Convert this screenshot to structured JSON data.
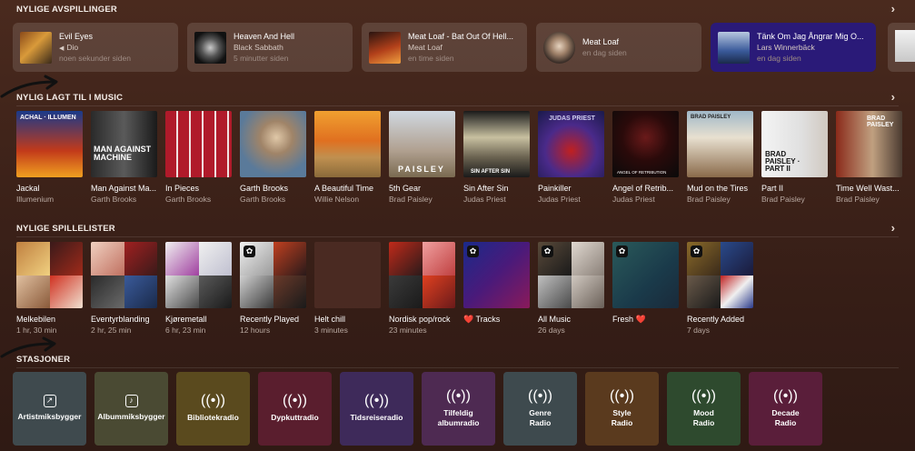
{
  "sections": {
    "recent_plays": "NYLIGE AVSPILLINGER",
    "recently_added": "NYLIG LAGT TIL I MUSIC",
    "recent_playlists": "NYLIGE SPILLELISTER",
    "stations": "STASJONER"
  },
  "recent_plays": [
    {
      "title": "Evil Eyes",
      "artist": "Dio",
      "time": "noen sekunder siden",
      "playing": true
    },
    {
      "title": "Heaven And Hell",
      "artist": "Black Sabbath",
      "time": "5 minutter siden"
    },
    {
      "title": "Meat Loaf - Bat Out Of Hell...",
      "artist": "Meat Loaf",
      "time": "en time siden"
    },
    {
      "title": "Meat Loaf",
      "artist": "",
      "time": "en dag siden"
    },
    {
      "title": "Tänk Om Jag Ångrar Mig O...",
      "artist": "Lars Winnerbäck",
      "time": "en dag siden"
    }
  ],
  "recently_added": [
    {
      "title": "Jackal",
      "artist": "Illumenium",
      "art_text": "ACHAL · ILLUMEN"
    },
    {
      "title": "Man Against Ma...",
      "artist": "Garth Brooks",
      "art_text": "MAN AGAINST MACHINE"
    },
    {
      "title": "In Pieces",
      "artist": "Garth Brooks"
    },
    {
      "title": "Garth Brooks",
      "artist": "Garth Brooks"
    },
    {
      "title": "A Beautiful Time",
      "artist": "Willie Nelson"
    },
    {
      "title": "5th Gear",
      "artist": "Brad Paisley",
      "art_text": "PAISLEY"
    },
    {
      "title": "Sin After Sin",
      "artist": "Judas Priest",
      "art_text": "SIN AFTER SIN"
    },
    {
      "title": "Painkiller",
      "artist": "Judas Priest",
      "art_text": "JUDAS PRIEST"
    },
    {
      "title": "Angel of Retrib...",
      "artist": "Judas Priest",
      "art_text": "ANGEL OF RETRIBUTION"
    },
    {
      "title": "Mud on the Tires",
      "artist": "Brad Paisley",
      "art_text": "BRAD PAISLEY"
    },
    {
      "title": "Part II",
      "artist": "Brad Paisley",
      "art_text": "BRAD PAISLEY · PART II"
    },
    {
      "title": "Time Well Wast...",
      "artist": "Brad Paisley",
      "art_text": "BRAD PAISLEY"
    }
  ],
  "recent_playlists": [
    {
      "title": "Melkebilen",
      "sub": "1 hr, 30 min"
    },
    {
      "title": "Eventyrblanding",
      "sub": "2 hr, 25 min"
    },
    {
      "title": "Kjøremetall",
      "sub": "6 hr, 23 min"
    },
    {
      "title": "Recently Played",
      "sub": "12 hours"
    },
    {
      "title": "Helt chill",
      "sub": "3 minutes"
    },
    {
      "title": "Nordisk pop/rock",
      "sub": "23 minutes"
    },
    {
      "title": "❤️ Tracks",
      "sub": ""
    },
    {
      "title": "All Music",
      "sub": "26 days"
    },
    {
      "title": "Fresh ❤️",
      "sub": ""
    },
    {
      "title": "Recently Added",
      "sub": "7 days"
    }
  ],
  "stations": [
    {
      "label": "Artistmiksbygger",
      "icon": "arrow-up-right-icon",
      "color": "#3f4a4e"
    },
    {
      "label": "Albummiksbygger",
      "icon": "music-note-icon",
      "color": "#4a4a33"
    },
    {
      "label": "Bibliotekradio",
      "icon": "broadcast-icon",
      "color": "#5a4a1e"
    },
    {
      "label": "Dypkuttradio",
      "icon": "broadcast-icon",
      "color": "#5a1e2e"
    },
    {
      "label": "Tidsreiseradio",
      "icon": "broadcast-icon",
      "color": "#3e2a5a"
    },
    {
      "label": "Tilfeldig albumradio",
      "icon": "broadcast-icon",
      "color": "#4e2a52"
    },
    {
      "label": "Genre Radio",
      "icon": "broadcast-icon",
      "color": "#3e4a4e"
    },
    {
      "label": "Style Radio",
      "icon": "broadcast-icon",
      "color": "#5a3a1e"
    },
    {
      "label": "Mood Radio",
      "icon": "broadcast-icon",
      "color": "#2e4a2e"
    },
    {
      "label": "Decade Radio",
      "icon": "broadcast-icon",
      "color": "#5a1e3a"
    }
  ]
}
